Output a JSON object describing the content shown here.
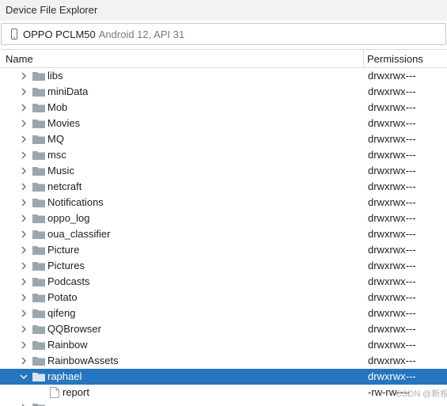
{
  "window": {
    "title": "Device File Explorer"
  },
  "device": {
    "name": "OPPO PCLM50",
    "detail": "Android 12, API 31"
  },
  "columns": {
    "name": "Name",
    "permissions": "Permissions"
  },
  "rows": [
    {
      "name": "libs",
      "permissions": "drwxrwx---",
      "type": "folder"
    },
    {
      "name": "miniData",
      "permissions": "drwxrwx---",
      "type": "folder"
    },
    {
      "name": "Mob",
      "permissions": "drwxrwx---",
      "type": "folder"
    },
    {
      "name": "Movies",
      "permissions": "drwxrwx---",
      "type": "folder"
    },
    {
      "name": "MQ",
      "permissions": "drwxrwx---",
      "type": "folder"
    },
    {
      "name": "msc",
      "permissions": "drwxrwx---",
      "type": "folder"
    },
    {
      "name": "Music",
      "permissions": "drwxrwx---",
      "type": "folder"
    },
    {
      "name": "netcraft",
      "permissions": "drwxrwx---",
      "type": "folder"
    },
    {
      "name": "Notifications",
      "permissions": "drwxrwx---",
      "type": "folder"
    },
    {
      "name": "oppo_log",
      "permissions": "drwxrwx---",
      "type": "folder"
    },
    {
      "name": "oua_classifier",
      "permissions": "drwxrwx---",
      "type": "folder"
    },
    {
      "name": "Picture",
      "permissions": "drwxrwx---",
      "type": "folder"
    },
    {
      "name": "Pictures",
      "permissions": "drwxrwx---",
      "type": "folder"
    },
    {
      "name": "Podcasts",
      "permissions": "drwxrwx---",
      "type": "folder"
    },
    {
      "name": "Potato",
      "permissions": "drwxrwx---",
      "type": "folder"
    },
    {
      "name": "qifeng",
      "permissions": "drwxrwx---",
      "type": "folder"
    },
    {
      "name": "QQBrowser",
      "permissions": "drwxrwx---",
      "type": "folder"
    },
    {
      "name": "Rainbow",
      "permissions": "drwxrwx---",
      "type": "folder"
    },
    {
      "name": "RainbowAssets",
      "permissions": "drwxrwx---",
      "type": "folder"
    },
    {
      "name": "raphael",
      "permissions": "drwxrwx---",
      "type": "folder",
      "expanded": true,
      "selected": true
    },
    {
      "name": "report",
      "permissions": "-rw-rw----",
      "type": "file",
      "child": true
    }
  ],
  "watermark": "CSDN @新根",
  "icons": {
    "chevron_collapsed": "chevron-right-icon",
    "chevron_expanded": "chevron-down-icon",
    "folder": "folder-icon",
    "file": "file-icon",
    "device": "phone-icon"
  },
  "colors": {
    "selection": "#2675bf",
    "folder": "#9aa7b0",
    "chevron": "#6e6e6e"
  }
}
